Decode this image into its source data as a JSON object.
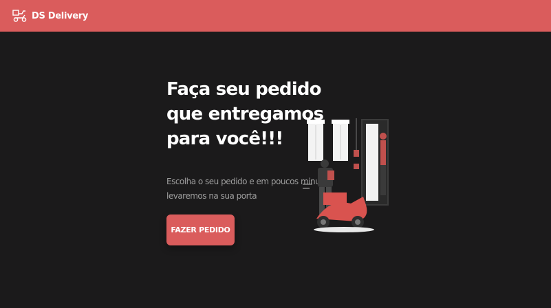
{
  "navbar": {
    "brand": "DS Delivery",
    "logo_icon": "delivery-scooter-icon",
    "background": "#da5c5c"
  },
  "hero": {
    "title_lines": [
      "Faça seu pedido",
      "que entregamos",
      "para você!!!"
    ],
    "subtitle_lines": [
      "Escolha o seu pedido e em poucos minutos",
      "levaremos na sua porta"
    ],
    "button_label": "FAZER PEDIDO",
    "illustration_icon": "delivery-person-scooter-illustration"
  },
  "colors": {
    "accent": "#da5c5c",
    "background": "#1b1a1b",
    "text": "#ffffff",
    "muted_text": "#9e9e9e"
  }
}
